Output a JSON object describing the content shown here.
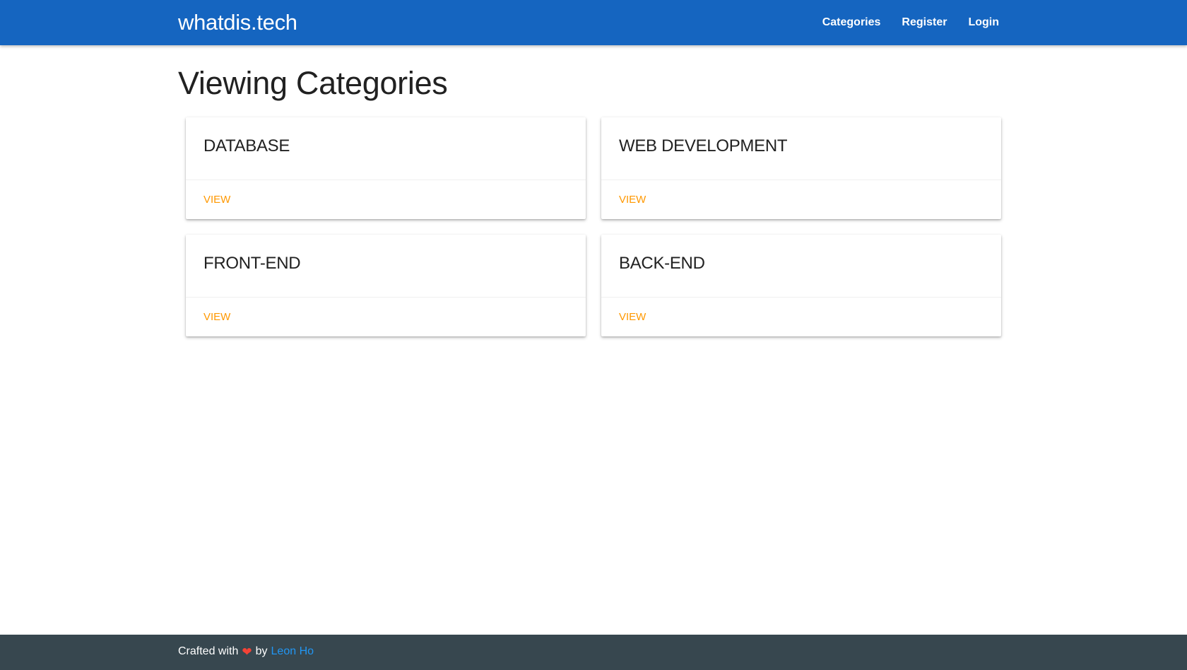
{
  "navbar": {
    "brand": "whatdis.tech",
    "links": [
      "Categories",
      "Register",
      "Login"
    ]
  },
  "page": {
    "title": "Viewing Categories"
  },
  "categories": [
    {
      "name": "DATABASE",
      "action": "VIEW"
    },
    {
      "name": "WEB DEVELOPMENT",
      "action": "VIEW"
    },
    {
      "name": "FRONT-END",
      "action": "VIEW"
    },
    {
      "name": "BACK-END",
      "action": "VIEW"
    }
  ],
  "footer": {
    "prefix": "Crafted with",
    "heart_icon": "heart-icon",
    "middle": "by",
    "author": "Leon Ho"
  },
  "colors": {
    "navbar": "#1565c0",
    "footer": "#37474f",
    "action": "#ff9800",
    "author_link": "#2196f3",
    "heart": "#f44336"
  }
}
